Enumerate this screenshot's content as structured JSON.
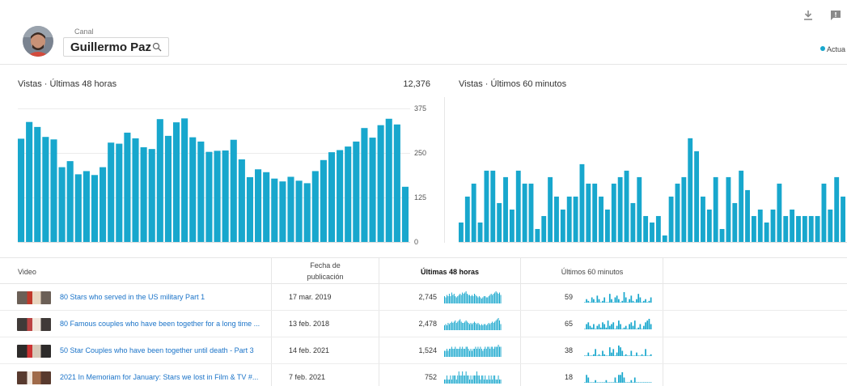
{
  "header": {
    "channel_label": "Canal",
    "channel_name": "Guillermo Paz",
    "status_label": "Actua",
    "accent_color": "#18a7cd"
  },
  "icons": [
    "download-icon",
    "feedback-icon",
    "search-icon"
  ],
  "charts": {
    "left": {
      "title": "Vistas · Últimas 48 horas",
      "total": "12,376",
      "ticks": [
        "375",
        "250",
        "125",
        "0"
      ],
      "values": [
        290,
        337,
        323,
        295,
        288,
        210,
        227,
        190,
        199,
        188,
        210,
        279,
        276,
        307,
        291,
        266,
        261,
        345,
        298,
        336,
        347,
        294,
        282,
        253,
        256,
        257,
        287,
        232,
        182,
        204,
        196,
        178,
        170,
        183,
        172,
        165,
        199,
        230,
        252,
        258,
        268,
        282,
        320,
        293,
        328,
        346,
        330,
        155
      ]
    },
    "right": {
      "title": "Vistas · Últimos 60 minutos",
      "values": [
        3,
        7,
        9,
        3,
        11,
        11,
        6,
        10,
        5,
        11,
        9,
        9,
        2,
        4,
        10,
        7,
        5,
        7,
        7,
        12,
        9,
        9,
        7,
        5,
        9,
        10,
        11,
        6,
        10,
        4,
        3,
        4,
        1,
        7,
        9,
        10,
        16,
        14,
        7,
        5,
        10,
        2,
        10,
        6,
        11,
        8,
        4,
        5,
        3,
        5,
        9,
        4,
        5,
        4,
        4,
        4,
        4,
        9,
        5,
        10,
        7
      ]
    }
  },
  "table": {
    "headers": {
      "video": "Video",
      "published_line1": "Fecha de",
      "published_line2": "publicación",
      "last48": "Últimas 48 horas",
      "last60": "Últimos 60 minutos"
    },
    "rows": [
      {
        "title": "80 Stars who served in the US military Part 1",
        "date": "17 mar. 2019",
        "views48": "2,745",
        "views60": "59",
        "spark48": [
          6,
          5,
          7,
          6,
          8,
          6,
          9,
          7,
          8,
          6,
          5,
          6,
          7,
          8,
          7,
          9,
          8,
          9,
          10,
          8,
          7,
          7,
          6,
          7,
          6,
          8,
          7,
          6,
          5,
          6,
          5,
          4,
          5,
          6,
          6,
          5,
          5,
          6,
          7,
          8,
          7,
          8,
          9,
          10,
          9,
          8,
          9,
          7
        ],
        "spark60": [
          0,
          2,
          1,
          0,
          3,
          2,
          0,
          4,
          2,
          0,
          1,
          3,
          0,
          0,
          5,
          2,
          0,
          3,
          4,
          2,
          0,
          1,
          6,
          3,
          0,
          2,
          4,
          1,
          0,
          2,
          5,
          3,
          0,
          1,
          2,
          0,
          1,
          3
        ]
      },
      {
        "title": "80 Famous couples who have been together for a long time ...",
        "date": "13 feb. 2018",
        "views48": "2,478",
        "views60": "65",
        "spark48": [
          4,
          5,
          4,
          6,
          5,
          6,
          7,
          6,
          7,
          8,
          6,
          7,
          8,
          9,
          7,
          6,
          6,
          7,
          8,
          7,
          6,
          5,
          6,
          5,
          6,
          7,
          6,
          5,
          6,
          5,
          4,
          5,
          4,
          5,
          5,
          4,
          5,
          6,
          5,
          6,
          7,
          6,
          7,
          8,
          9,
          10,
          8,
          5
        ],
        "spark60": [
          0,
          3,
          4,
          2,
          1,
          3,
          0,
          2,
          3,
          1,
          4,
          3,
          1,
          5,
          2,
          3,
          4,
          0,
          2,
          5,
          3,
          0,
          1,
          2,
          0,
          3,
          4,
          2,
          5,
          0,
          1,
          3,
          0,
          2,
          4,
          5,
          6,
          3
        ]
      },
      {
        "title": "50 Star Couples who have been together until death - Part 3",
        "date": "14 feb. 2021",
        "views48": "1,524",
        "views60": "38",
        "spark48": [
          3,
          3,
          4,
          3,
          4,
          4,
          5,
          4,
          4,
          5,
          4,
          4,
          4,
          5,
          4,
          5,
          4,
          4,
          5,
          5,
          4,
          3,
          4,
          3,
          4,
          4,
          5,
          4,
          5,
          4,
          5,
          4,
          3,
          4,
          5,
          4,
          5,
          5,
          4,
          5,
          5,
          4,
          5,
          5,
          5,
          6,
          5,
          5
        ],
        "spark60": [
          0,
          0,
          2,
          0,
          0,
          1,
          4,
          0,
          1,
          0,
          3,
          1,
          0,
          0,
          5,
          2,
          4,
          0,
          2,
          6,
          5,
          3,
          0,
          1,
          0,
          0,
          3,
          0,
          0,
          2,
          0,
          0,
          1,
          0,
          4,
          0,
          0,
          1
        ]
      },
      {
        "title": "2021 In Memoriam for January: Stars we lost in Film & TV #...",
        "date": "7 feb. 2021",
        "views48": "752",
        "views60": "18",
        "spark48": [
          1,
          1,
          2,
          1,
          1,
          2,
          1,
          2,
          2,
          2,
          1,
          2,
          3,
          2,
          2,
          3,
          2,
          2,
          3,
          2,
          2,
          1,
          2,
          1,
          2,
          2,
          2,
          3,
          2,
          2,
          1,
          2,
          2,
          1,
          2,
          1,
          1,
          2,
          1,
          2,
          1,
          2,
          2,
          1,
          1,
          2,
          1,
          1
        ],
        "spark60": [
          0,
          3,
          2,
          0,
          0,
          0,
          1,
          0,
          0,
          0,
          0,
          0,
          1,
          0,
          0,
          0,
          0,
          2,
          0,
          3,
          3,
          4,
          2,
          0,
          0,
          0,
          1,
          0,
          2,
          0,
          0,
          0,
          0,
          0,
          0,
          0,
          0,
          0
        ]
      }
    ]
  }
}
